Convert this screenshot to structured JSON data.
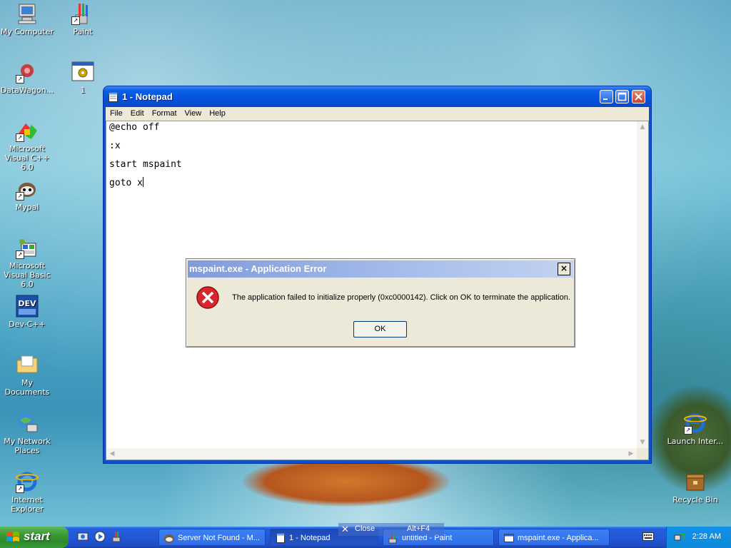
{
  "desktop": {
    "icons_left": [
      {
        "label": "My Computer",
        "icon": "my-computer-icon"
      },
      {
        "label": "DataWagon...",
        "icon": "datawagon-icon"
      },
      {
        "label": "Microsoft Visual C++ 6.0",
        "icon": "visual-cpp-icon"
      },
      {
        "label": "Mypal",
        "icon": "mypal-icon"
      },
      {
        "label": "Microsoft Visual Basic 6.0",
        "icon": "visual-basic-icon"
      },
      {
        "label": "Dev-C++",
        "icon": "dev-cpp-icon"
      },
      {
        "label": "My Documents",
        "icon": "my-documents-icon"
      },
      {
        "label": "My Network Places",
        "icon": "network-places-icon"
      },
      {
        "label": "Internet Explorer",
        "icon": "internet-explorer-icon"
      }
    ],
    "icons_col2": [
      {
        "label": "Paint",
        "icon": "paint-icon"
      },
      {
        "label": "1",
        "icon": "batch-file-icon"
      }
    ],
    "icons_right": [
      {
        "label": "Launch Inter...",
        "icon": "internet-explorer-icon"
      },
      {
        "label": "Recycle Bin",
        "icon": "recycle-bin-icon"
      }
    ]
  },
  "notepad": {
    "title": "1 - Notepad",
    "menu": [
      "File",
      "Edit",
      "Format",
      "View",
      "Help"
    ],
    "lines": [
      "@echo off",
      ":x",
      "start mspaint",
      "goto x"
    ]
  },
  "dialog": {
    "title": "mspaint.exe - Application Error",
    "message": "The application failed to initialize properly (0xc0000142). Click on OK to terminate the application.",
    "ok_label": "OK",
    "close_glyph": "×"
  },
  "taskbar": {
    "start_label": "start",
    "tasks": [
      {
        "label": "Server Not Found - M...",
        "icon": "mypal-icon"
      },
      {
        "label": "1 - Notepad",
        "icon": "notepad-icon"
      },
      {
        "label": "untitled - Paint",
        "icon": "paint-icon"
      },
      {
        "label": "mspaint.exe - Applica...",
        "icon": "window-icon"
      }
    ],
    "clock": "2:28 AM"
  },
  "tooltip": {
    "close_label": "Close",
    "shortcut": "Alt+F4"
  },
  "colors": {
    "title_blue": "#0a50d8",
    "start_green": "#3c9c37",
    "dialog_bg": "#ece9d8",
    "error_red": "#d8262c"
  }
}
